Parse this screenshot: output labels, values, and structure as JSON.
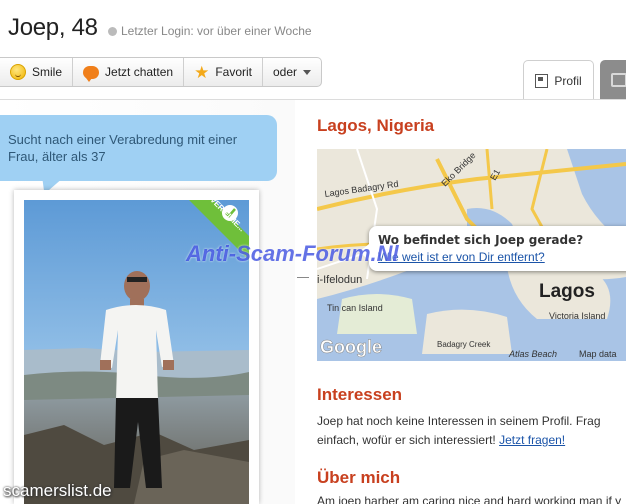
{
  "profile": {
    "name_age": "Joep, 48",
    "last_login": "Letzter Login: vor über einer Woche"
  },
  "actions": {
    "smile": "Smile",
    "chat": "Jetzt chatten",
    "favorite": "Favorit",
    "more": "oder"
  },
  "tabs": {
    "profile": "Profil"
  },
  "looking_for": "Sucht nach einer Verabredung mit einer Frau, älter als 37",
  "photo": {
    "verified_badge": "VERIFIZIE..."
  },
  "location": {
    "heading": "Lagos, Nigeria",
    "map_labels": {
      "road1": "Lagos Badagry Rd",
      "road2": "Eko Bridge",
      "road3": "E1",
      "area1": "i-Ifelodun",
      "area2": "Tin can Island",
      "city": "Lagos",
      "area3": "Victoria Island",
      "area4": "Badagry Creek",
      "area5": "Atlas Beach",
      "mapdata": "Map data",
      "google": "Google"
    },
    "popup_question": "Wo befindet sich Joep gerade?",
    "popup_link": "Wie weit ist er von Dir entfernt?"
  },
  "interests": {
    "heading": "Interessen",
    "line1": "Joep hat noch keine Interessen in seinem Profil. Frag",
    "line2": "einfach, wofür er sich interessiert!",
    "link": "Jetzt fragen!"
  },
  "about": {
    "heading": "Über mich",
    "text": "Am joep harber am caring nice and hard working man if y"
  },
  "watermarks": {
    "center": "Anti-Scam-Forum.Nl",
    "left": "scamerslist.de"
  },
  "colors": {
    "heading": "#c8401f",
    "link": "#1b54a8",
    "bubble": "#9fd0f3",
    "verified": "#6fbf3a"
  }
}
